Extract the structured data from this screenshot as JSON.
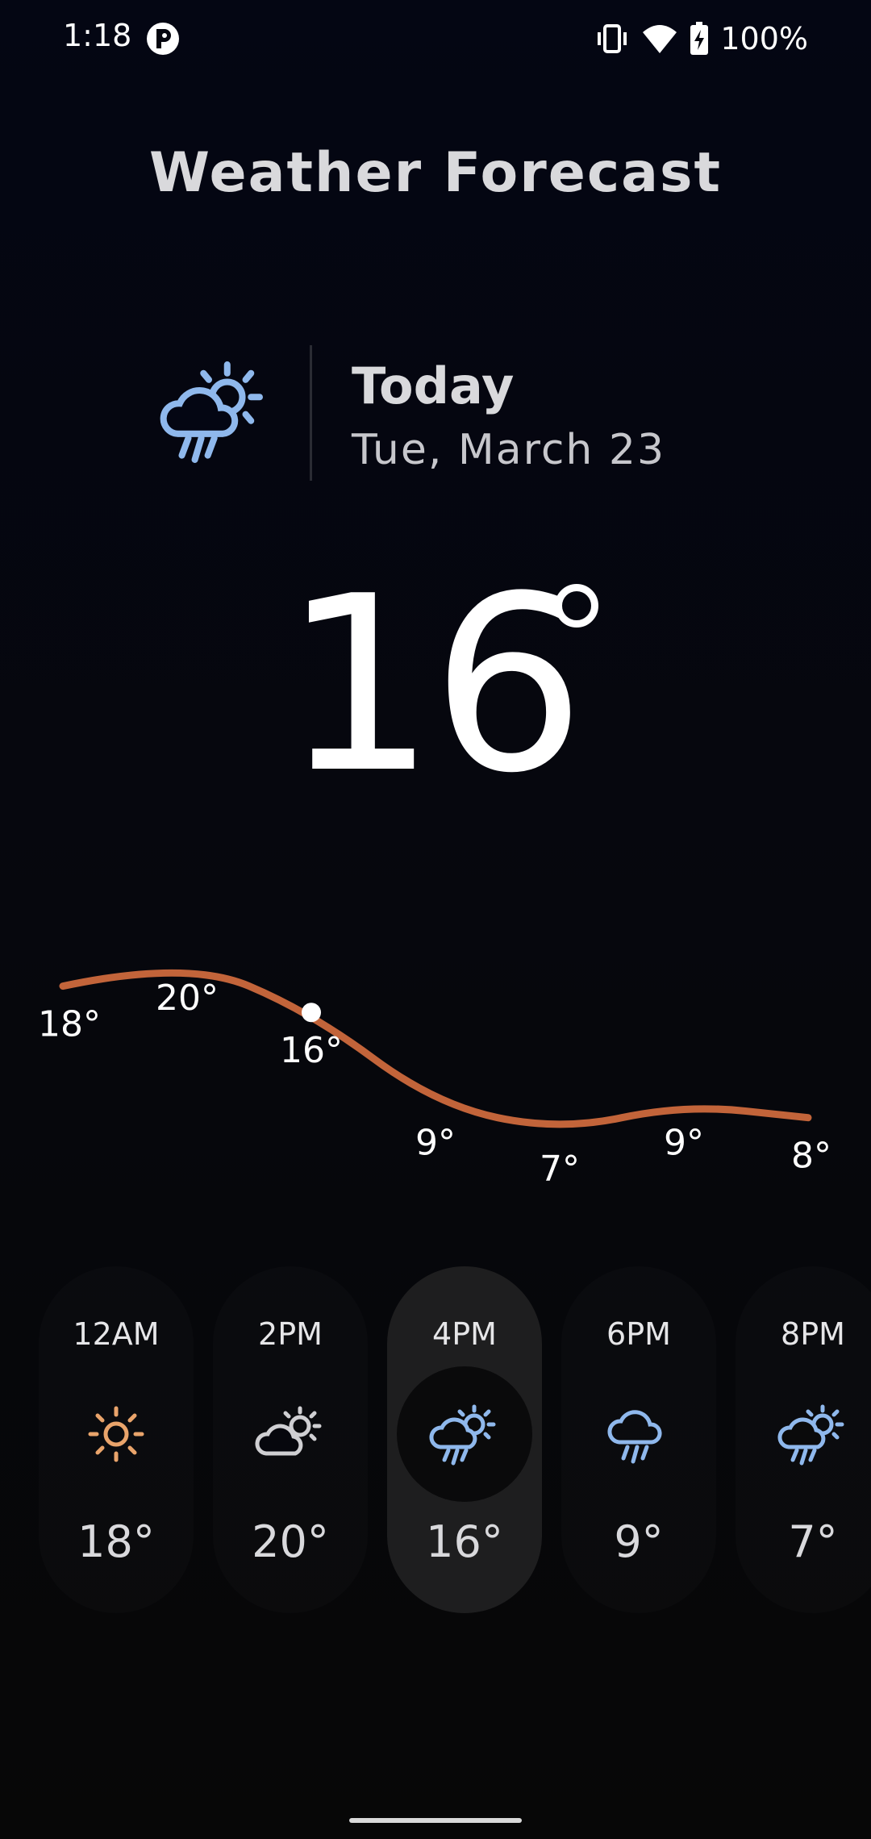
{
  "status_bar": {
    "time": "1:18",
    "battery": "100%",
    "icons": [
      "app-notification-icon",
      "vibrate-icon",
      "wifi-icon",
      "battery-charging-icon"
    ]
  },
  "app": {
    "title": "Weather Forecast"
  },
  "today": {
    "label": "Today",
    "date": "Tue, March 23",
    "icon": "rain-sun-icon"
  },
  "current": {
    "temperature": "16"
  },
  "colors": {
    "line": "#c2643a",
    "sun": "#e9a46b",
    "rain": "#8fb8ec",
    "cloud": "#cfcfd2",
    "card_selected": "#1e1e1f"
  },
  "chart_data": {
    "type": "line",
    "title": "",
    "xlabel": "",
    "ylabel": "",
    "categories": [
      "12AM",
      "2PM",
      "4PM",
      "6PM",
      "8PM",
      "",
      ""
    ],
    "series": [
      {
        "values": [
          18,
          20,
          16,
          9,
          7,
          9,
          8
        ]
      }
    ],
    "labels": [
      "18°",
      "20°",
      "16°",
      "9°",
      "7°",
      "9°",
      "8°"
    ],
    "highlight_index": 2,
    "ylim": [
      7,
      20
    ],
    "grid": false,
    "legend": "none"
  },
  "hourly": [
    {
      "time": "12AM",
      "icon": "sun-icon",
      "temp": "18°",
      "selected": false
    },
    {
      "time": "2PM",
      "icon": "partly-cloudy-icon",
      "temp": "20°",
      "selected": false
    },
    {
      "time": "4PM",
      "icon": "rain-sun-icon",
      "temp": "16°",
      "selected": true
    },
    {
      "time": "6PM",
      "icon": "rain-icon",
      "temp": "9°",
      "selected": false
    },
    {
      "time": "8PM",
      "icon": "rain-sun-icon",
      "temp": "7°",
      "selected": false
    }
  ]
}
